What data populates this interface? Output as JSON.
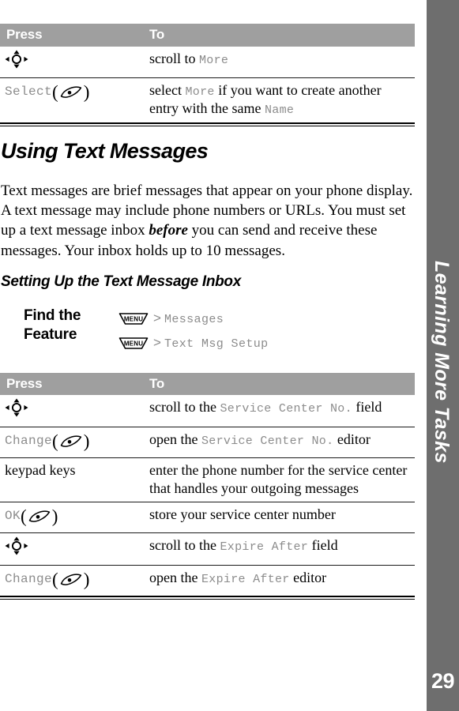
{
  "sidebar": {
    "chapter_label": "Learning More Tasks",
    "page_number": "29",
    "bar_color": "#6e6e6e",
    "text_color": "#ffffff"
  },
  "table_header": {
    "press": "Press",
    "to": "To",
    "background": "#9f9f9f",
    "text_color": "#ffffff"
  },
  "table_top": {
    "rows": [
      {
        "press_icon": "navigation-key-icon",
        "press_label": "",
        "to_parts": [
          {
            "text": "scroll to ",
            "style": "plain"
          },
          {
            "text": "More",
            "style": "keyword"
          }
        ]
      },
      {
        "press_icon": "soft-key-icon",
        "press_label": "Select",
        "to_parts": [
          {
            "text": "select ",
            "style": "plain"
          },
          {
            "text": "More",
            "style": "keyword"
          },
          {
            "text": " if you want to create another entry with the same ",
            "style": "plain"
          },
          {
            "text": "Name",
            "style": "keyword"
          }
        ]
      }
    ]
  },
  "section": {
    "heading": "Using Text Messages",
    "paragraph_parts": [
      {
        "text": "Text messages are brief messages that appear on your phone display. A text message may include phone numbers or URLs. You must set up a text message inbox ",
        "style": "plain"
      },
      {
        "text": "before",
        "style": "emphasis"
      },
      {
        "text": " you can send and receive these messages. Your inbox holds up to 10 messages.",
        "style": "plain"
      }
    ],
    "subheading": "Setting Up the Text Message Inbox"
  },
  "find_the_feature": {
    "label_line1": "Find the",
    "label_line2": "Feature",
    "steps": [
      {
        "key_icon": "menu-key-icon",
        "key_label": "MENU",
        "separator": ">",
        "target": "Messages"
      },
      {
        "key_icon": "menu-key-icon",
        "key_label": "MENU",
        "separator": ">",
        "target": "Text Msg Setup"
      }
    ]
  },
  "table_bottom": {
    "rows": [
      {
        "press_icon": "navigation-key-icon",
        "press_label": "",
        "to_parts": [
          {
            "text": "scroll to the ",
            "style": "plain"
          },
          {
            "text": "Service Center No.",
            "style": "keyword"
          },
          {
            "text": " field",
            "style": "plain"
          }
        ]
      },
      {
        "press_icon": "soft-key-icon",
        "press_label": "Change",
        "to_parts": [
          {
            "text": "open the ",
            "style": "plain"
          },
          {
            "text": "Service Center No.",
            "style": "keyword"
          },
          {
            "text": " editor",
            "style": "plain"
          }
        ]
      },
      {
        "press_icon": "none",
        "press_label": "keypad keys",
        "press_label_style": "plain",
        "to_parts": [
          {
            "text": "enter the phone number for the service center that handles your outgoing messages",
            "style": "plain"
          }
        ]
      },
      {
        "press_icon": "soft-key-icon",
        "press_label": "OK",
        "to_parts": [
          {
            "text": "store your service center number",
            "style": "plain"
          }
        ]
      },
      {
        "press_icon": "navigation-key-icon",
        "press_label": "",
        "to_parts": [
          {
            "text": "scroll to the ",
            "style": "plain"
          },
          {
            "text": "Expire After",
            "style": "keyword"
          },
          {
            "text": " field",
            "style": "plain"
          }
        ]
      },
      {
        "press_icon": "soft-key-icon",
        "press_label": "Change",
        "to_parts": [
          {
            "text": "open the ",
            "style": "plain"
          },
          {
            "text": "Expire After",
            "style": "keyword"
          },
          {
            "text": " editor",
            "style": "plain"
          }
        ]
      }
    ]
  }
}
